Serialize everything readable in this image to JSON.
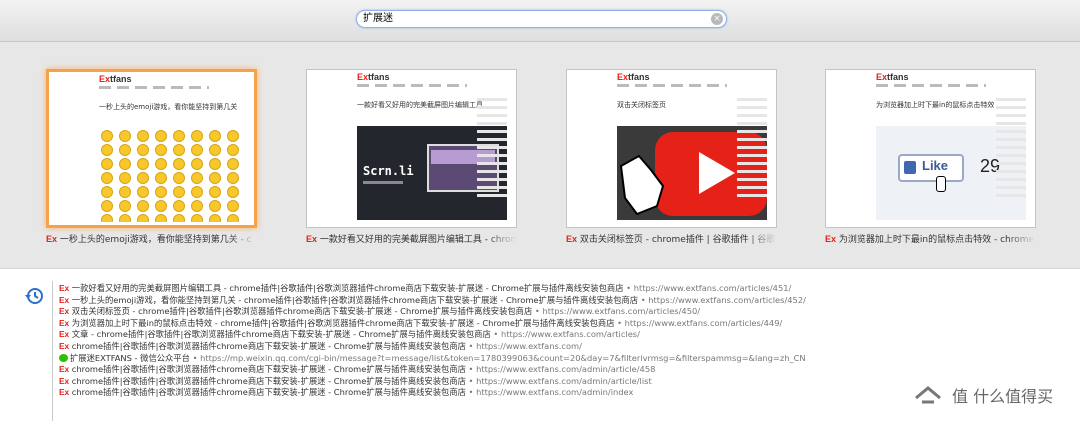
{
  "search": {
    "value": "扩展迷",
    "clear_glyph": "×"
  },
  "brand": {
    "ex": "Ex",
    "name": "tfans"
  },
  "thumbnails": [
    {
      "tag": "Ex",
      "title": "一秒上头的emoji游戏，看你能坚持到第几关",
      "label": "一秒上头的emoji游戏，看你能坚持到第几关 - c",
      "selected": true
    },
    {
      "tag": "Ex",
      "title": "一款好看又好用的完美截屏图片编辑工具",
      "label": "一款好看又好用的完美截屏图片编辑工具 - chrome",
      "card_text": "Scrn.li",
      "selected": false
    },
    {
      "tag": "Ex",
      "title": "双击关闭标签页",
      "label": "双击关闭标签页 - chrome插件 | 谷歌插件 | 谷歌",
      "selected": false
    },
    {
      "tag": "Ex",
      "title": "为浏览器加上时下最in的鼠标点击特效",
      "label": "为浏览器加上时下最in的鼠标点击特效 - chrome",
      "like_text": "Like",
      "like_count": "29",
      "selected": false
    }
  ],
  "history": [
    {
      "tag": "Ex",
      "title": "一款好看又好用的完美截屏图片编辑工具 - chrome插件|谷歌插件|谷歌浏览器插件chrome商店下载安装-扩展迷 - Chrome扩展与插件离线安装包商店",
      "url": "https://www.extfans.com/articles/451/"
    },
    {
      "tag": "Ex",
      "title": "一秒上头的emoji游戏，看你能坚持到第几关 - chrome插件|谷歌插件|谷歌浏览器插件chrome商店下载安装-扩展迷 - Chrome扩展与插件离线安装包商店",
      "url": "https://www.extfans.com/articles/452/"
    },
    {
      "tag": "Ex",
      "title": "双击关闭标签页 - chrome插件|谷歌插件|谷歌浏览器插件chrome商店下载安装-扩展迷 - Chrome扩展与插件离线安装包商店",
      "url": "https://www.extfans.com/articles/450/"
    },
    {
      "tag": "Ex",
      "title": "为浏览器加上时下最in的鼠标点击特效 - chrome插件|谷歌插件|谷歌浏览器插件chrome商店下载安装-扩展迷 - Chrome扩展与插件离线安装包商店",
      "url": "https://www.extfans.com/articles/449/"
    },
    {
      "tag": "Ex",
      "title": "文章 - chrome插件|谷歌插件|谷歌浏览器插件chrome商店下载安装-扩展迷 - Chrome扩展与插件离线安装包商店",
      "url": "https://www.extfans.com/articles/"
    },
    {
      "tag": "Ex",
      "title": "chrome插件|谷歌插件|谷歌浏览器插件chrome商店下载安装-扩展迷 - Chrome扩展与插件离线安装包商店",
      "url": "https://www.extfans.com/"
    },
    {
      "tag": "",
      "wechat": true,
      "title": "扩展迷EXTFANS - 微信公众平台",
      "url": "https://mp.weixin.qq.com/cgi-bin/message?t=message/list&token=1780399063&count=20&day=7&filterivrmsg=&filterspammsg=&lang=zh_CN"
    },
    {
      "tag": "Ex",
      "title": "chrome插件|谷歌插件|谷歌浏览器插件chrome商店下载安装-扩展迷 - Chrome扩展与插件离线安装包商店",
      "url": "https://www.extfans.com/admin/article/458"
    },
    {
      "tag": "Ex",
      "title": "chrome插件|谷歌插件|谷歌浏览器插件chrome商店下载安装-扩展迷 - Chrome扩展与插件离线安装包商店",
      "url": "https://www.extfans.com/admin/article/list"
    },
    {
      "tag": "Ex",
      "title": "chrome插件|谷歌插件|谷歌浏览器插件chrome商店下载安装-扩展迷 - Chrome扩展与插件离线安装包商店",
      "url": "https://www.extfans.com/admin/index"
    }
  ],
  "url_separator": " • ",
  "watermark": "值 什么值得买",
  "colors": {
    "accent_orange": "#f5a24a",
    "ex_red": "#e2231a",
    "youtube_red": "#e62117",
    "history_blue": "#2a72c7"
  }
}
